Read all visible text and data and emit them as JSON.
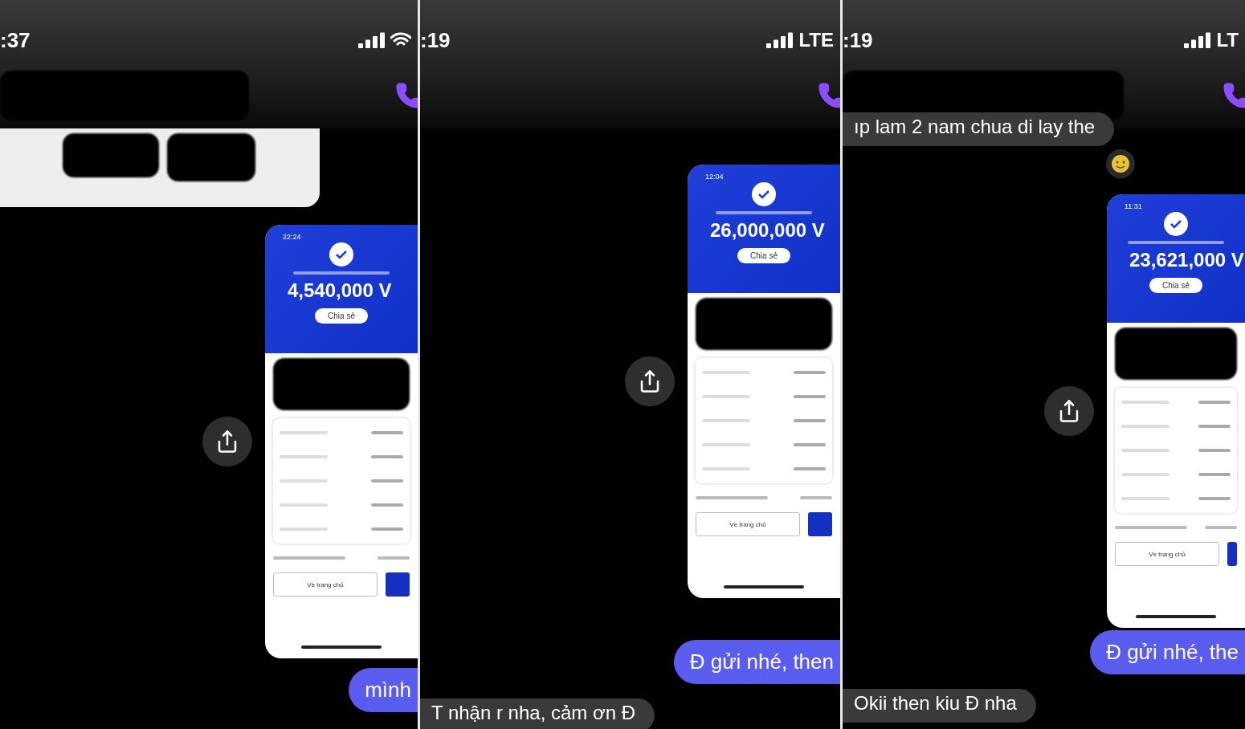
{
  "panels": [
    {
      "status": {
        "time": ":37",
        "wifi": true
      },
      "header": {
        "redacted": true
      },
      "messages": [
        {
          "kind": "image"
        },
        {
          "kind": "receipt",
          "time": "22:24",
          "amount": "4,540,000 V",
          "share_label": "Chia sẻ",
          "home_button": "Về trang chủ"
        },
        {
          "kind": "outgoing",
          "text": "mình"
        }
      ]
    },
    {
      "status": {
        "time": ":19",
        "network": "LTE"
      },
      "header": {
        "redacted": false
      },
      "messages": [
        {
          "kind": "receipt",
          "time": "12:04",
          "amount": "26,000,000 V",
          "share_label": "Chia sẻ",
          "home_button": "Về trang chủ"
        },
        {
          "kind": "outgoing",
          "text": "Đ gửi nhé, then"
        },
        {
          "kind": "incoming",
          "text": "T nhận r nha, cảm ơn Đ"
        }
      ]
    },
    {
      "status": {
        "time": ":19",
        "network": "LT"
      },
      "header": {
        "redacted": true
      },
      "messages": [
        {
          "kind": "incoming",
          "text": "ıp lam 2 nam chua di lay the",
          "reacted": true
        },
        {
          "kind": "receipt",
          "time": "11:31",
          "amount": "23,621,000 V",
          "share_label": "Chia sẻ",
          "home_button": "Về trang chủ"
        },
        {
          "kind": "outgoing",
          "text": "Đ gửi nhé, the"
        },
        {
          "kind": "incoming",
          "text": "Okii then kiu Đ nha"
        }
      ]
    }
  ]
}
